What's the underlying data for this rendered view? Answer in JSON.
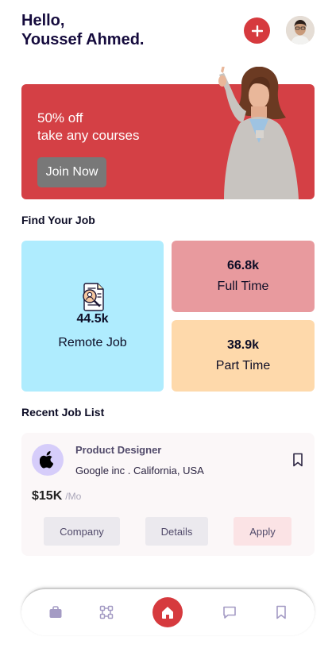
{
  "header": {
    "greeting_line1": "Hello,",
    "greeting_line2": "Youssef Ahmed.",
    "add_icon": "plus-icon"
  },
  "banner": {
    "line1": "50% off",
    "line2": "take any courses",
    "button_label": "Join Now",
    "background_color": "#d44045"
  },
  "find_job": {
    "title": "Find Your Job",
    "cards": [
      {
        "value": "44.5k",
        "label": "Remote Job",
        "color": "#afecfe",
        "icon": "job-search-icon"
      },
      {
        "value": "66.8k",
        "label": "Full Time",
        "color": "#e89a9e"
      },
      {
        "value": "38.9k",
        "label": "Part Time",
        "color": "#fed9ab"
      }
    ]
  },
  "recent_jobs": {
    "title": "Recent Job List",
    "items": [
      {
        "title": "Product Designer",
        "company_location": "Google inc . California, USA",
        "salary": "$15K",
        "salary_unit": "/Mo",
        "logo_icon": "apple-icon",
        "buttons": {
          "company": "Company",
          "details": "Details",
          "apply": "Apply"
        }
      }
    ]
  },
  "bottom_nav": {
    "items": [
      "bag-icon",
      "connect-icon",
      "home-icon",
      "chat-icon",
      "bookmark-icon"
    ],
    "active": "home-icon",
    "accent_color": "#d63a3e"
  }
}
